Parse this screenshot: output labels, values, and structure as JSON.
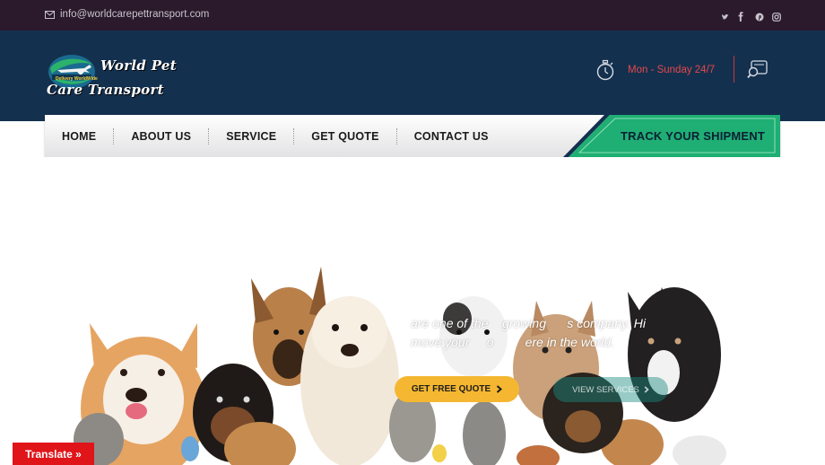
{
  "topbar": {
    "email": "info@worldcarepettransport.com",
    "social_icons": [
      "twitter-icon",
      "facebook-icon",
      "pinterest-icon",
      "instagram-icon"
    ]
  },
  "header": {
    "logo_line1": "World Pet",
    "logo_line2": "Care Transport",
    "logo_tagline": "Delivery WorldWide",
    "hours": "Mon - Sunday 24/7"
  },
  "nav": {
    "items": [
      "HOME",
      "ABOUT US",
      "SERVICE",
      "GET QUOTE",
      "CONTACT US"
    ],
    "track_label": "TRACK YOUR SHIPMENT"
  },
  "hero": {
    "line1": "are one of the    growing      s company. Hi",
    "line2": "move your     o         ere in the world.",
    "quote_button": "GET FREE QUOTE",
    "view_button": "VIEW SERVICES"
  },
  "translate_label": "Translate »",
  "colors": {
    "topbar": "#2a1a2c",
    "header": "#14304f",
    "accent_green": "#1fae73",
    "accent_yellow": "#f5b731",
    "translate_red": "#e0151a",
    "hours_text": "#e4474a"
  }
}
